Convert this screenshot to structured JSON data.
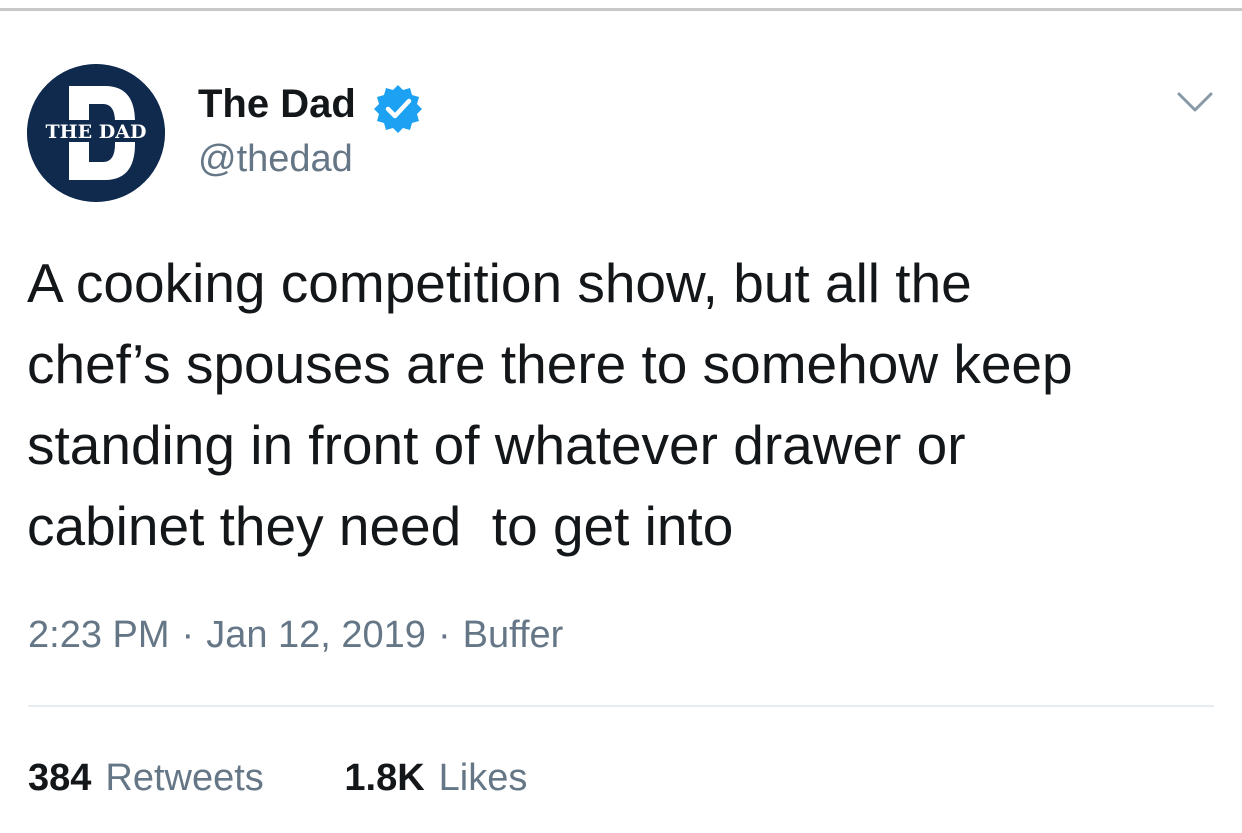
{
  "tweet": {
    "author": {
      "display_name": "The Dad",
      "handle": "@thedad",
      "avatar_text": "THE DAD",
      "verified": true
    },
    "text_lines": [
      "A cooking competition show, but all the",
      "chef’s spouses are there to somehow keep",
      "standing in front of whatever drawer or",
      "cabinet they need  to get into"
    ],
    "time": "2:23 PM",
    "date": "Jan 12, 2019",
    "source": "Buffer",
    "separator": "·",
    "stats": {
      "retweets_count": "384",
      "retweets_label": "Retweets",
      "likes_count": "1.8K",
      "likes_label": "Likes"
    }
  },
  "icons": {
    "verified": "verified-badge-icon",
    "more": "chevron-down-icon"
  },
  "colors": {
    "primary_text": "#14171a",
    "secondary_text": "#657786",
    "verified_blue": "#1da1f2",
    "avatar_navy": "#0f2a4d"
  }
}
